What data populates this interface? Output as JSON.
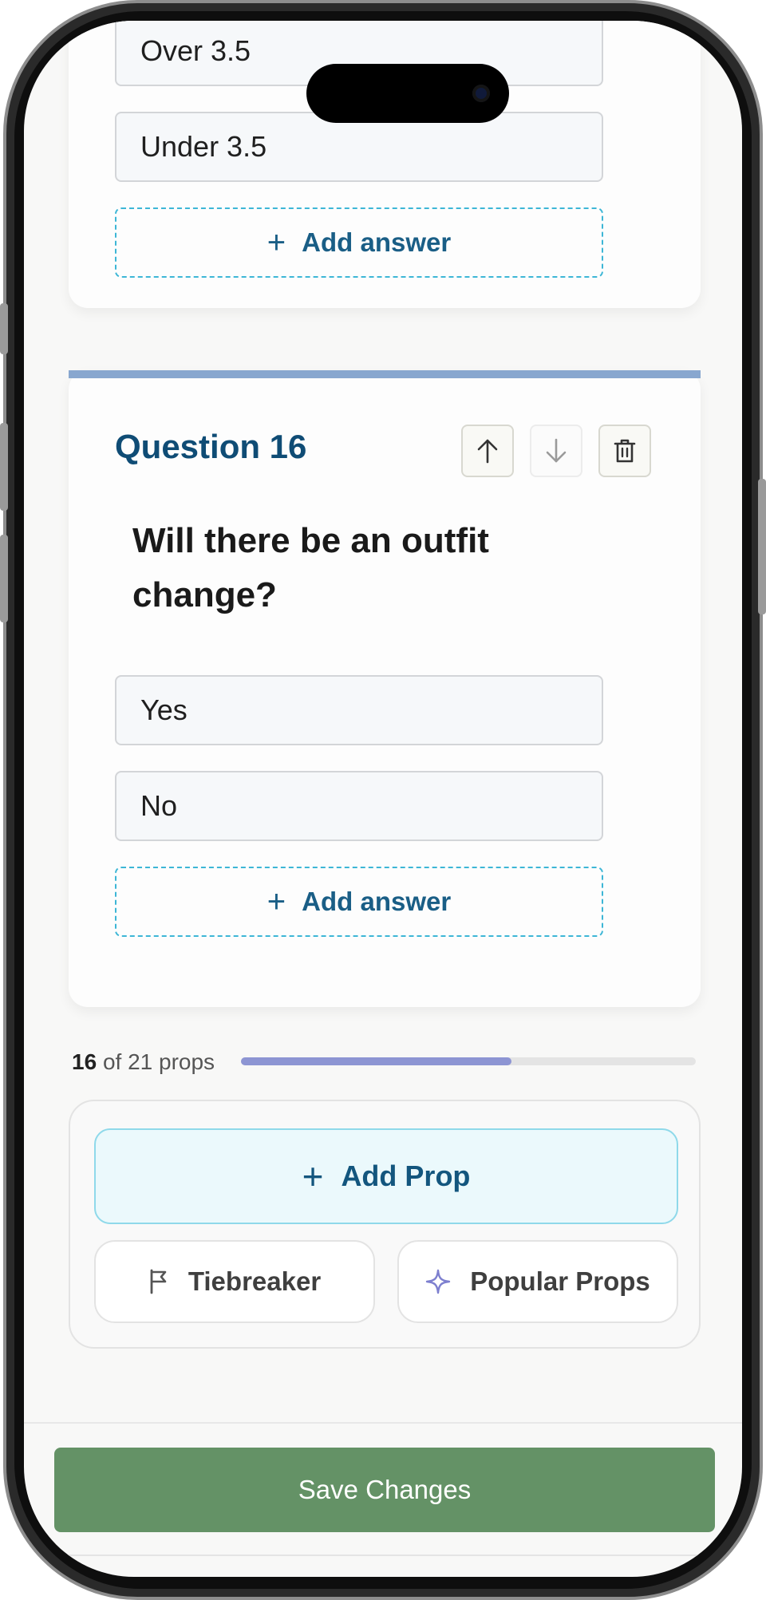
{
  "prev_question": {
    "answers": [
      "Over 3.5",
      "Under 3.5"
    ],
    "add_answer_label": "Add answer"
  },
  "question": {
    "title": "Question 16",
    "text": "Will there be an outfit change?",
    "answers": [
      "Yes",
      "No"
    ],
    "add_answer_label": "Add answer"
  },
  "progress": {
    "current": "16",
    "suffix": "of 21 props",
    "fraction": 0.595
  },
  "actions": {
    "add_prop_label": "Add Prop",
    "tiebreaker_label": "Tiebreaker",
    "popular_label": "Popular Props"
  },
  "footer": {
    "save_label": "Save Changes"
  },
  "colors": {
    "accent_blue": "#0f4c75",
    "save_green": "#649266",
    "progress_fill": "#8d95d3",
    "dashed_border": "#3db6d6"
  }
}
